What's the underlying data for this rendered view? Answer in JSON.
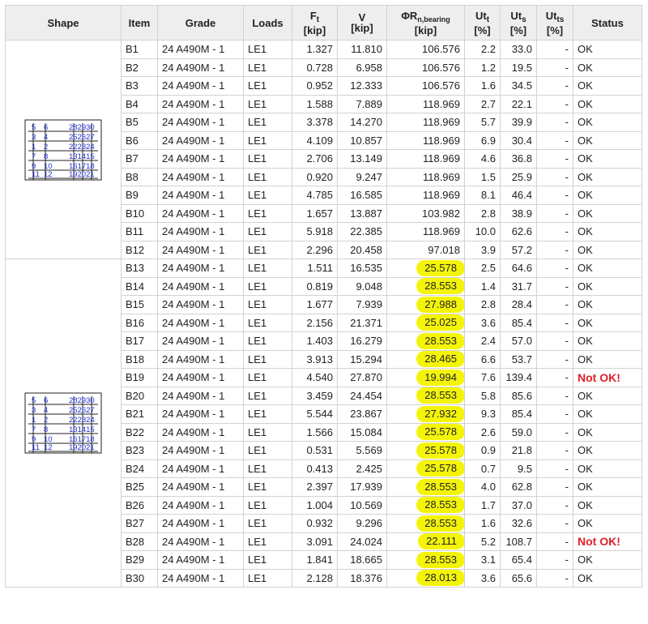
{
  "headers": {
    "shape": "Shape",
    "item": "Item",
    "grade": "Grade",
    "loads": "Loads",
    "ft_main": "F",
    "ft_sub": "t",
    "ft_unit": "[kip]",
    "v_main": "V",
    "v_unit": "[kip]",
    "phirn_main": "ΦR",
    "phirn_sub": "n,bearing",
    "phirn_unit": "[kip]",
    "utt_main": "Ut",
    "utt_sub": "t",
    "utt_unit": "[%]",
    "uts_main": "Ut",
    "uts_sub": "s",
    "uts_unit": "[%]",
    "utts_main": "Ut",
    "utts_sub": "ts",
    "utts_unit": "[%]",
    "status": "Status"
  },
  "pattern_labels": {
    "left": [
      [
        "5",
        "6"
      ],
      [
        "3",
        "4"
      ],
      [
        "1",
        "2"
      ],
      [
        "7",
        "8"
      ],
      [
        "9",
        "10"
      ],
      [
        "11",
        "12"
      ]
    ],
    "right": [
      "282930",
      "252627",
      "222324",
      "131415",
      "161718",
      "192021"
    ]
  },
  "groups": [
    {
      "rows": [
        {
          "item": "B1",
          "grade": "24 A490M - 1",
          "loads": "LE1",
          "ft": "1.327",
          "v": "11.810",
          "phirn": "106.576",
          "utt": "2.2",
          "uts": "33.0",
          "utts": "-",
          "status": "OK",
          "hl": false,
          "fail": false
        },
        {
          "item": "B2",
          "grade": "24 A490M - 1",
          "loads": "LE1",
          "ft": "0.728",
          "v": "6.958",
          "phirn": "106.576",
          "utt": "1.2",
          "uts": "19.5",
          "utts": "-",
          "status": "OK",
          "hl": false,
          "fail": false
        },
        {
          "item": "B3",
          "grade": "24 A490M - 1",
          "loads": "LE1",
          "ft": "0.952",
          "v": "12.333",
          "phirn": "106.576",
          "utt": "1.6",
          "uts": "34.5",
          "utts": "-",
          "status": "OK",
          "hl": false,
          "fail": false
        },
        {
          "item": "B4",
          "grade": "24 A490M - 1",
          "loads": "LE1",
          "ft": "1.588",
          "v": "7.889",
          "phirn": "118.969",
          "utt": "2.7",
          "uts": "22.1",
          "utts": "-",
          "status": "OK",
          "hl": false,
          "fail": false
        },
        {
          "item": "B5",
          "grade": "24 A490M - 1",
          "loads": "LE1",
          "ft": "3.378",
          "v": "14.270",
          "phirn": "118.969",
          "utt": "5.7",
          "uts": "39.9",
          "utts": "-",
          "status": "OK",
          "hl": false,
          "fail": false
        },
        {
          "item": "B6",
          "grade": "24 A490M - 1",
          "loads": "LE1",
          "ft": "4.109",
          "v": "10.857",
          "phirn": "118.969",
          "utt": "6.9",
          "uts": "30.4",
          "utts": "-",
          "status": "OK",
          "hl": false,
          "fail": false
        },
        {
          "item": "B7",
          "grade": "24 A490M - 1",
          "loads": "LE1",
          "ft": "2.706",
          "v": "13.149",
          "phirn": "118.969",
          "utt": "4.6",
          "uts": "36.8",
          "utts": "-",
          "status": "OK",
          "hl": false,
          "fail": false
        },
        {
          "item": "B8",
          "grade": "24 A490M - 1",
          "loads": "LE1",
          "ft": "0.920",
          "v": "9.247",
          "phirn": "118.969",
          "utt": "1.5",
          "uts": "25.9",
          "utts": "-",
          "status": "OK",
          "hl": false,
          "fail": false
        },
        {
          "item": "B9",
          "grade": "24 A490M - 1",
          "loads": "LE1",
          "ft": "4.785",
          "v": "16.585",
          "phirn": "118.969",
          "utt": "8.1",
          "uts": "46.4",
          "utts": "-",
          "status": "OK",
          "hl": false,
          "fail": false
        },
        {
          "item": "B10",
          "grade": "24 A490M - 1",
          "loads": "LE1",
          "ft": "1.657",
          "v": "13.887",
          "phirn": "103.982",
          "utt": "2.8",
          "uts": "38.9",
          "utts": "-",
          "status": "OK",
          "hl": false,
          "fail": false
        },
        {
          "item": "B11",
          "grade": "24 A490M - 1",
          "loads": "LE1",
          "ft": "5.918",
          "v": "22.385",
          "phirn": "118.969",
          "utt": "10.0",
          "uts": "62.6",
          "utts": "-",
          "status": "OK",
          "hl": false,
          "fail": false
        },
        {
          "item": "B12",
          "grade": "24 A490M - 1",
          "loads": "LE1",
          "ft": "2.296",
          "v": "20.458",
          "phirn": "97.018",
          "utt": "3.9",
          "uts": "57.2",
          "utts": "-",
          "status": "OK",
          "hl": false,
          "fail": false
        }
      ]
    },
    {
      "rows": [
        {
          "item": "B13",
          "grade": "24 A490M - 1",
          "loads": "LE1",
          "ft": "1.511",
          "v": "16.535",
          "phirn": "25.578",
          "utt": "2.5",
          "uts": "64.6",
          "utts": "-",
          "status": "OK",
          "hl": true,
          "fail": false
        },
        {
          "item": "B14",
          "grade": "24 A490M - 1",
          "loads": "LE1",
          "ft": "0.819",
          "v": "9.048",
          "phirn": "28.553",
          "utt": "1.4",
          "uts": "31.7",
          "utts": "-",
          "status": "OK",
          "hl": true,
          "fail": false
        },
        {
          "item": "B15",
          "grade": "24 A490M - 1",
          "loads": "LE1",
          "ft": "1.677",
          "v": "7.939",
          "phirn": "27.988",
          "utt": "2.8",
          "uts": "28.4",
          "utts": "-",
          "status": "OK",
          "hl": true,
          "fail": false
        },
        {
          "item": "B16",
          "grade": "24 A490M - 1",
          "loads": "LE1",
          "ft": "2.156",
          "v": "21.371",
          "phirn": "25.025",
          "utt": "3.6",
          "uts": "85.4",
          "utts": "-",
          "status": "OK",
          "hl": true,
          "fail": false
        },
        {
          "item": "B17",
          "grade": "24 A490M - 1",
          "loads": "LE1",
          "ft": "1.403",
          "v": "16.279",
          "phirn": "28.553",
          "utt": "2.4",
          "uts": "57.0",
          "utts": "-",
          "status": "OK",
          "hl": true,
          "fail": false
        },
        {
          "item": "B18",
          "grade": "24 A490M - 1",
          "loads": "LE1",
          "ft": "3.913",
          "v": "15.294",
          "phirn": "28.465",
          "utt": "6.6",
          "uts": "53.7",
          "utts": "-",
          "status": "OK",
          "hl": true,
          "fail": false
        },
        {
          "item": "B19",
          "grade": "24 A490M - 1",
          "loads": "LE1",
          "ft": "4.540",
          "v": "27.870",
          "phirn": "19.994",
          "utt": "7.6",
          "uts": "139.4",
          "utts": "-",
          "status": "Not OK!",
          "hl": true,
          "fail": true
        },
        {
          "item": "B20",
          "grade": "24 A490M - 1",
          "loads": "LE1",
          "ft": "3.459",
          "v": "24.454",
          "phirn": "28.553",
          "utt": "5.8",
          "uts": "85.6",
          "utts": "-",
          "status": "OK",
          "hl": true,
          "fail": false
        },
        {
          "item": "B21",
          "grade": "24 A490M - 1",
          "loads": "LE1",
          "ft": "5.544",
          "v": "23.867",
          "phirn": "27.932",
          "utt": "9.3",
          "uts": "85.4",
          "utts": "-",
          "status": "OK",
          "hl": true,
          "fail": false
        },
        {
          "item": "B22",
          "grade": "24 A490M - 1",
          "loads": "LE1",
          "ft": "1.566",
          "v": "15.084",
          "phirn": "25.578",
          "utt": "2.6",
          "uts": "59.0",
          "utts": "-",
          "status": "OK",
          "hl": true,
          "fail": false
        },
        {
          "item": "B23",
          "grade": "24 A490M - 1",
          "loads": "LE1",
          "ft": "0.531",
          "v": "5.569",
          "phirn": "25.578",
          "utt": "0.9",
          "uts": "21.8",
          "utts": "-",
          "status": "OK",
          "hl": true,
          "fail": false
        },
        {
          "item": "B24",
          "grade": "24 A490M - 1",
          "loads": "LE1",
          "ft": "0.413",
          "v": "2.425",
          "phirn": "25.578",
          "utt": "0.7",
          "uts": "9.5",
          "utts": "-",
          "status": "OK",
          "hl": true,
          "fail": false
        },
        {
          "item": "B25",
          "grade": "24 A490M - 1",
          "loads": "LE1",
          "ft": "2.397",
          "v": "17.939",
          "phirn": "28.553",
          "utt": "4.0",
          "uts": "62.8",
          "utts": "-",
          "status": "OK",
          "hl": true,
          "fail": false
        },
        {
          "item": "B26",
          "grade": "24 A490M - 1",
          "loads": "LE1",
          "ft": "1.004",
          "v": "10.569",
          "phirn": "28.553",
          "utt": "1.7",
          "uts": "37.0",
          "utts": "-",
          "status": "OK",
          "hl": true,
          "fail": false
        },
        {
          "item": "B27",
          "grade": "24 A490M - 1",
          "loads": "LE1",
          "ft": "0.932",
          "v": "9.296",
          "phirn": "28.553",
          "utt": "1.6",
          "uts": "32.6",
          "utts": "-",
          "status": "OK",
          "hl": true,
          "fail": false
        },
        {
          "item": "B28",
          "grade": "24 A490M - 1",
          "loads": "LE1",
          "ft": "3.091",
          "v": "24.024",
          "phirn": "22.111",
          "utt": "5.2",
          "uts": "108.7",
          "utts": "-",
          "status": "Not OK!",
          "hl": true,
          "fail": true
        },
        {
          "item": "B29",
          "grade": "24 A490M - 1",
          "loads": "LE1",
          "ft": "1.841",
          "v": "18.665",
          "phirn": "28.553",
          "utt": "3.1",
          "uts": "65.4",
          "utts": "-",
          "status": "OK",
          "hl": true,
          "fail": false
        },
        {
          "item": "B30",
          "grade": "24 A490M - 1",
          "loads": "LE1",
          "ft": "2.128",
          "v": "18.376",
          "phirn": "28.013",
          "utt": "3.6",
          "uts": "65.6",
          "utts": "-",
          "status": "OK",
          "hl": true,
          "fail": false
        }
      ]
    }
  ],
  "colors": {
    "header_bg": "#eeeeee",
    "border": "#d2d2d2",
    "highlight": "#f4f40a",
    "fail_text": "#e0202a",
    "bolt_label": "#2030d0"
  }
}
